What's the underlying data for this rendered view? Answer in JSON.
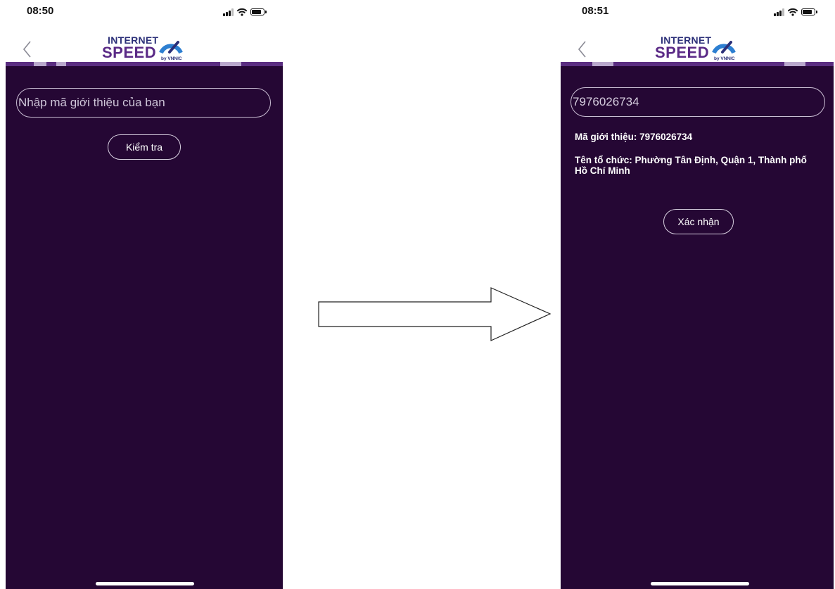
{
  "left_screen": {
    "status_time": "08:50",
    "logo": {
      "line1": "INTERNET",
      "line2": "SPEED",
      "by": "by VNNIC"
    },
    "input": {
      "placeholder": "Nhập mã giới thiệu của bạn",
      "value": ""
    },
    "check_button_label": "Kiểm tra"
  },
  "right_screen": {
    "status_time": "08:51",
    "logo": {
      "line1": "INTERNET",
      "line2": "SPEED",
      "by": "by VNNIC"
    },
    "input": {
      "value": "7976026734"
    },
    "referral_code_text": "Mã giới thiệu: 7976026734",
    "organization_text": "Tên tổ chức: Phường Tân Định, Quận 1, Thành phố Hồ Chí Minh",
    "confirm_button_label": "Xác nhận"
  },
  "icons": {
    "back": "chevron-left-icon",
    "signal": "cellular-signal-icon",
    "wifi": "wifi-icon",
    "battery": "battery-icon",
    "transition": "right-arrow-icon"
  },
  "colors": {
    "background": "#250734",
    "tab_strip": "#5a2d80",
    "logo_primary": "#2b2f78",
    "logo_speed": "#5a2a86",
    "logo_accent": "#2d7fd1",
    "text": "#ffffff"
  }
}
